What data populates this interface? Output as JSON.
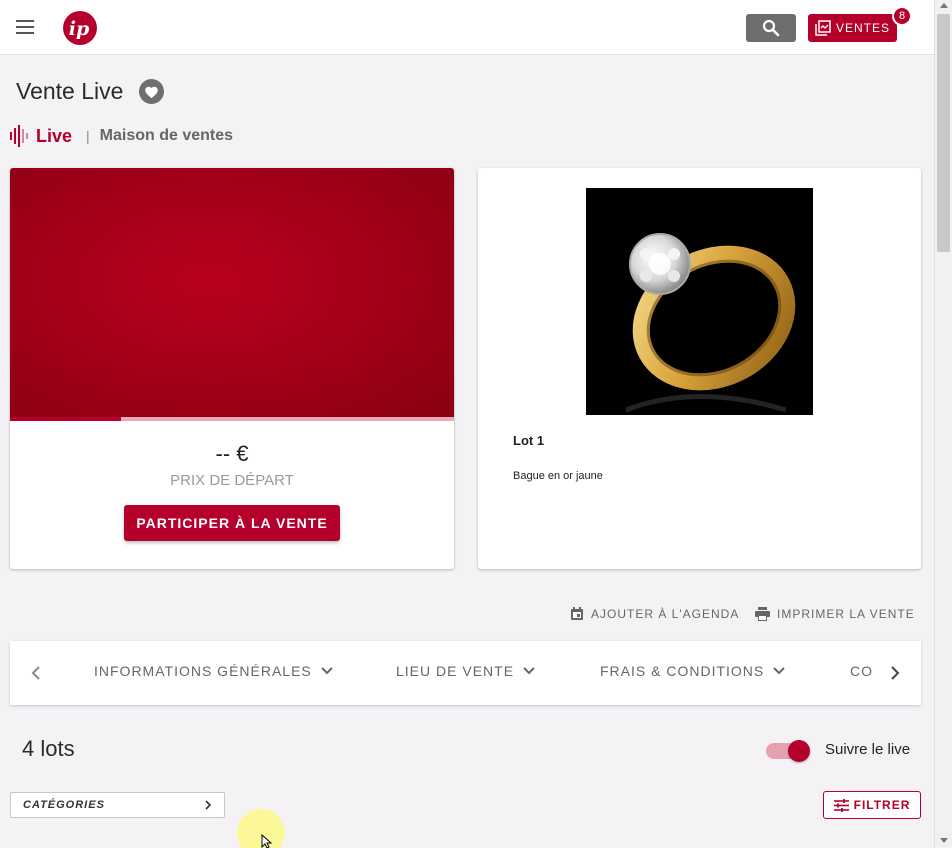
{
  "topbar": {
    "ventes_label": "VENTES",
    "ventes_badge": "8"
  },
  "header": {
    "title": "Vente Live",
    "live_label": "Live",
    "separator": "|",
    "house_label": "Maison de ventes"
  },
  "live_card": {
    "price": "-- €",
    "price_label": "PRIX DE DÉPART",
    "participate_label": "PARTICIPER À LA VENTE",
    "progress_fraction": 0.25
  },
  "lot_card": {
    "title": "Lot 1",
    "description": "Bague en or jaune"
  },
  "actions": {
    "agenda_label": "AJOUTER À L'AGENDA",
    "print_label": "IMPRIMER LA VENTE"
  },
  "tabs": [
    {
      "label": "INFORMATIONS GÉNÉRALES"
    },
    {
      "label": "LIEU DE VENTE"
    },
    {
      "label": "FRAIS & CONDITIONS"
    },
    {
      "label": "CO"
    }
  ],
  "lots": {
    "count_label": "4 lots",
    "follow_label": "Suivre le live",
    "follow_enabled": true
  },
  "filters": {
    "categories_label": "CATÉGORIES",
    "filter_label": "FILTRER"
  },
  "colors": {
    "brand": "#b5002c",
    "background": "#f4f2f5"
  }
}
